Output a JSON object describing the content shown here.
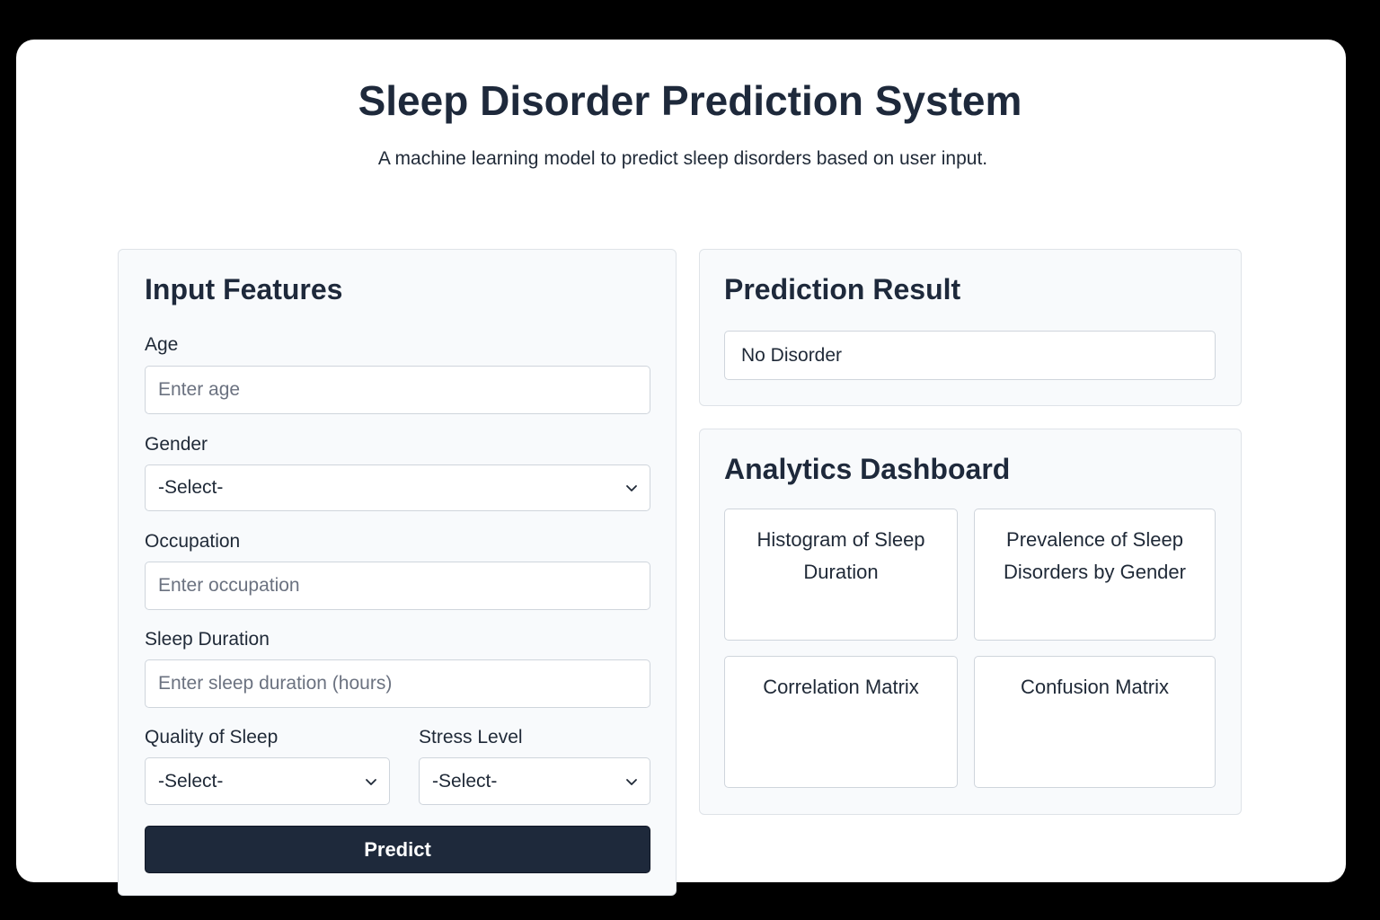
{
  "header": {
    "title": "Sleep Disorder Prediction System",
    "subtitle": "A machine learning model to predict sleep disorders based on user input."
  },
  "input_features": {
    "title": "Input Features",
    "age": {
      "label": "Age",
      "placeholder": "Enter age",
      "value": ""
    },
    "gender": {
      "label": "Gender",
      "selected": "-Select-"
    },
    "occupation": {
      "label": "Occupation",
      "placeholder": "Enter occupation",
      "value": ""
    },
    "sleep_duration": {
      "label": "Sleep Duration",
      "placeholder": "Enter sleep duration (hours)",
      "value": ""
    },
    "quality_of_sleep": {
      "label": "Quality of Sleep",
      "selected": "-Select-"
    },
    "stress_level": {
      "label": "Stress Level",
      "selected": "-Select-"
    },
    "predict_label": "Predict"
  },
  "prediction_result": {
    "title": "Prediction Result",
    "value": "No Disorder"
  },
  "analytics": {
    "title": "Analytics Dashboard",
    "tiles": [
      {
        "label": "Histogram of Sleep Duration"
      },
      {
        "label": "Prevalence of Sleep Disorders by Gender"
      },
      {
        "label": "Correlation Matrix"
      },
      {
        "label": "Confusion Matrix"
      }
    ]
  },
  "colors": {
    "primary_button": "#1e293b",
    "heading_text": "#1e293b",
    "card_background": "#f8fafc",
    "page_background": "#ffffff"
  },
  "icons": {
    "select_indicator": "chevron-down-icon"
  }
}
